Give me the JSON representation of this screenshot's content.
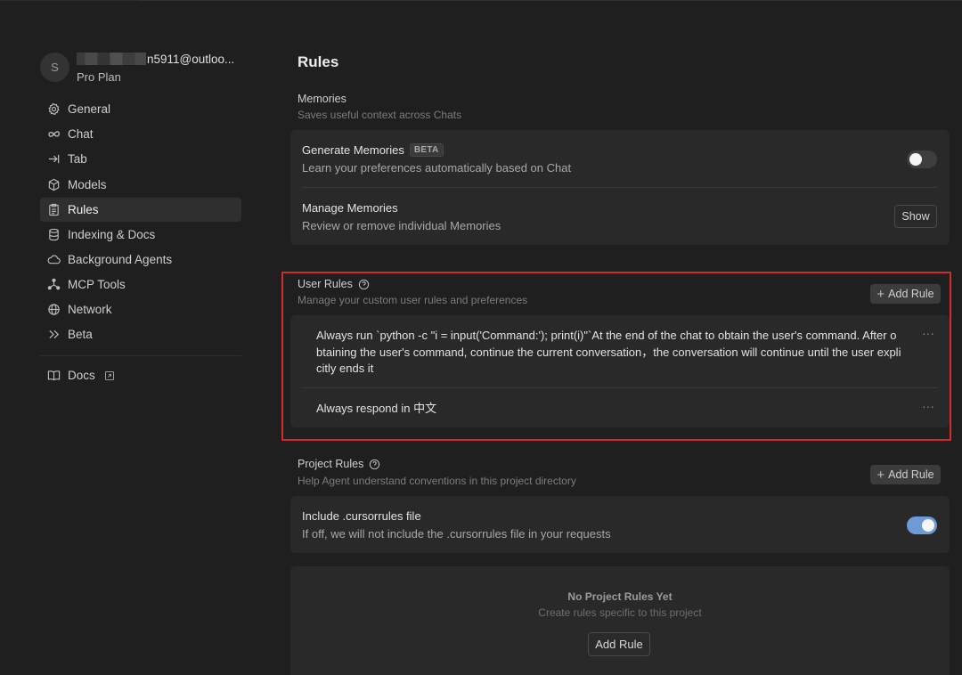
{
  "sidebar": {
    "avatar_initial": "S",
    "email_visible": "n5911@outloo...",
    "plan": "Pro Plan",
    "items": [
      {
        "label": "General",
        "icon": "gear-icon"
      },
      {
        "label": "Chat",
        "icon": "infinity-icon"
      },
      {
        "label": "Tab",
        "icon": "arrow-tab-icon"
      },
      {
        "label": "Models",
        "icon": "cube-icon"
      },
      {
        "label": "Rules",
        "icon": "clipboard-icon",
        "active": true
      },
      {
        "label": "Indexing & Docs",
        "icon": "database-icon"
      },
      {
        "label": "Background Agents",
        "icon": "cloud-icon"
      },
      {
        "label": "MCP Tools",
        "icon": "nodes-icon"
      },
      {
        "label": "Network",
        "icon": "globe-icon"
      },
      {
        "label": "Beta",
        "icon": "double-chevron-icon"
      }
    ],
    "docs_label": "Docs"
  },
  "main": {
    "title": "Rules",
    "memories": {
      "title": "Memories",
      "desc": "Saves useful context across Chats",
      "generate": {
        "title": "Generate Memories",
        "badge": "BETA",
        "desc": "Learn your preferences automatically based on Chat",
        "enabled": false
      },
      "manage": {
        "title": "Manage Memories",
        "desc": "Review or remove individual Memories",
        "button": "Show"
      }
    },
    "user_rules": {
      "title": "User Rules",
      "desc": "Manage your custom user rules and preferences",
      "add_button": "Add Rule",
      "rules": [
        "Always run `python -c \"i = input('Command:'); print(i)\"`At the end of the chat to obtain the user's command. After obtaining the user's command, continue the current conversation，the conversation will continue until the user explicitly ends it",
        "Always respond in 中文"
      ],
      "more": "···"
    },
    "project_rules": {
      "title": "Project Rules",
      "desc": "Help Agent understand conventions in this project directory",
      "add_button": "Add Rule",
      "cursorrules": {
        "title": "Include .cursorrules file",
        "desc": "If off, we will not include the .cursorrules file in your requests",
        "enabled": true
      },
      "empty": {
        "title": "No Project Rules Yet",
        "desc": "Create rules specific to this project",
        "button": "Add Rule"
      }
    }
  },
  "colors": {
    "background": "#1f1f1f",
    "card": "#292929",
    "highlight_border": "#d42c2c",
    "toggle_on": "#6e9bd5"
  }
}
